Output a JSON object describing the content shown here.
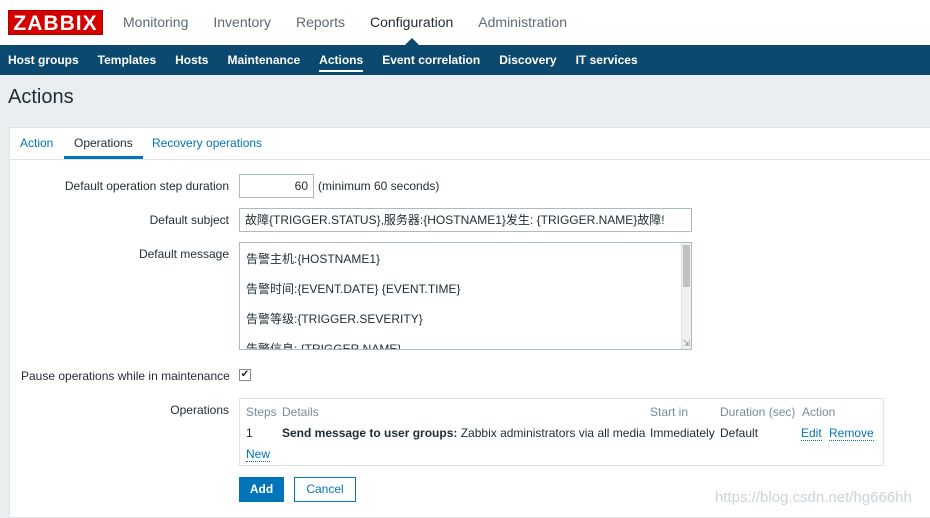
{
  "logo": "ZABBIX",
  "main_nav": [
    {
      "label": "Monitoring"
    },
    {
      "label": "Inventory"
    },
    {
      "label": "Reports"
    },
    {
      "label": "Configuration",
      "active": true
    },
    {
      "label": "Administration"
    }
  ],
  "sub_nav": [
    {
      "label": "Host groups"
    },
    {
      "label": "Templates"
    },
    {
      "label": "Hosts"
    },
    {
      "label": "Maintenance"
    },
    {
      "label": "Actions",
      "active": true
    },
    {
      "label": "Event correlation"
    },
    {
      "label": "Discovery"
    },
    {
      "label": "IT services"
    }
  ],
  "page_title": "Actions",
  "tabs": [
    {
      "label": "Action"
    },
    {
      "label": "Operations",
      "active": true
    },
    {
      "label": "Recovery operations"
    }
  ],
  "form": {
    "step_duration_label": "Default operation step duration",
    "step_duration_value": "60",
    "step_duration_hint": "(minimum 60 seconds)",
    "subject_label": "Default subject",
    "subject_value": "故障{TRIGGER.STATUS},服务器:{HOSTNAME1}发生: {TRIGGER.NAME}故障!",
    "message_label": "Default message",
    "message_lines": [
      "告警主机:{HOSTNAME1}",
      "告警时间:{EVENT.DATE} {EVENT.TIME}",
      "告警等级:{TRIGGER.SEVERITY}",
      "告警信息: {TRIGGER.NAME}"
    ],
    "pause_label": "Pause operations while in maintenance",
    "pause_checked": true,
    "operations_label": "Operations"
  },
  "operations_table": {
    "headers": {
      "steps": "Steps",
      "details": "Details",
      "start_in": "Start in",
      "duration": "Duration (sec)",
      "action": "Action"
    },
    "rows": [
      {
        "steps": "1",
        "details_bold": "Send message to user groups:",
        "details_rest": " Zabbix administrators via all media",
        "start_in": "Immediately",
        "duration": "Default",
        "edit": "Edit",
        "remove": "Remove"
      }
    ],
    "new_link": "New"
  },
  "buttons": {
    "add": "Add",
    "cancel": "Cancel"
  },
  "watermark": "https://blog.csdn.net/hg666hh"
}
